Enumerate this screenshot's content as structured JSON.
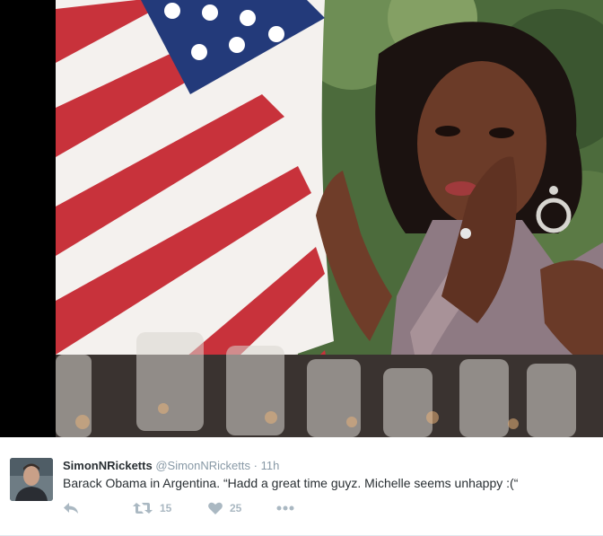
{
  "tweet": {
    "display_name": "SimonNRicketts",
    "screen_name": "@SimonNRicketts",
    "separator": "·",
    "timestamp": "11h",
    "text": "Barack Obama in Argentina. “Hadd a great time guyz. Michelle seems unhappy :(“"
  },
  "actions": {
    "reply_icon": "reply-icon",
    "retweet_icon": "retweet-icon",
    "retweet_count": "15",
    "like_icon": "heart-icon",
    "like_count": "25",
    "more_icon": "more-icon"
  },
  "colors": {
    "name": "#292f33",
    "muted": "#8899a6",
    "action_icon": "#aab8c2",
    "flag_red": "#c8323b",
    "flag_blue": "#233a7a"
  }
}
